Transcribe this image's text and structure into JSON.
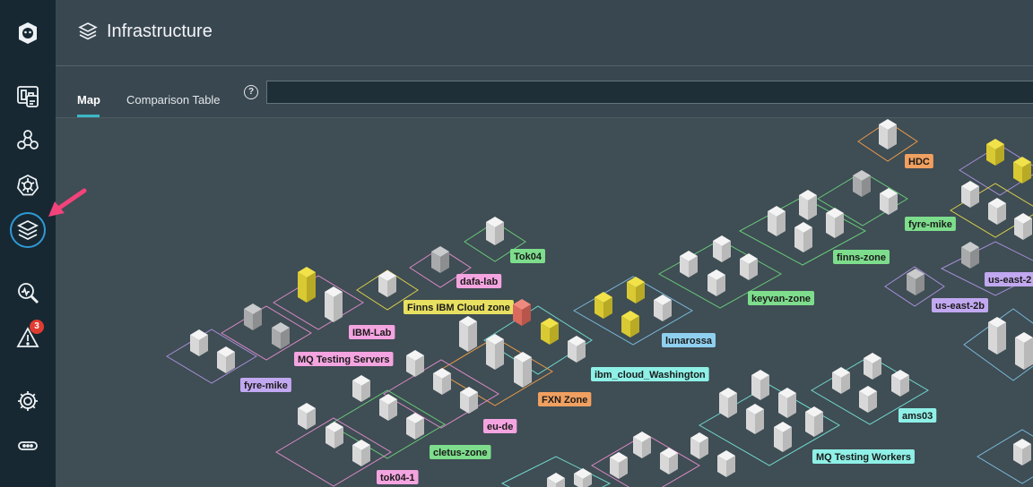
{
  "header": {
    "title": "Infrastructure"
  },
  "tabs": [
    {
      "label": "Map"
    },
    {
      "label": "Comparison Table"
    }
  ],
  "search": {
    "value": "",
    "placeholder": ""
  },
  "sidebar": {
    "items": [
      {
        "icon": "app-logo-icon"
      },
      {
        "icon": "dashboard-icon"
      },
      {
        "icon": "applications-icon"
      },
      {
        "icon": "kubernetes-icon"
      },
      {
        "icon": "infrastructure-stack-icon",
        "active": true
      },
      {
        "icon": "analyze-icon"
      },
      {
        "icon": "events-warning-icon",
        "badge": "3"
      },
      {
        "icon": "settings-gear-icon"
      },
      {
        "icon": "more-icon"
      }
    ]
  },
  "colors": {
    "accent": "#3bb8c6",
    "highlight_arrow": "#f2437a",
    "badge": "#e03c31",
    "host_default": "#f0f0f0",
    "host_warning": "#e6d63a",
    "host_critical": "#e57366"
  },
  "zones": [
    {
      "name": "HDC",
      "tag_color": "#f0a060",
      "border": "#e89a4a",
      "hosts": [
        "default"
      ]
    },
    {
      "name": "fyre-mike",
      "tag_color": "#7ddd8c",
      "border": "#68c97a",
      "hosts": [
        "dim",
        "default"
      ]
    },
    {
      "name": "Tok04",
      "tag_color": "#7ddd8c",
      "border": "#68c97a",
      "hosts": [
        "default"
      ]
    },
    {
      "name": "dafa-lab",
      "tag_color": "#f4a4e0",
      "border": "#d98ac6",
      "hosts": [
        "dim"
      ]
    },
    {
      "name": "finns-zone",
      "tag_color": "#7ddd8c",
      "border": "#68c97a",
      "hosts": [
        "default",
        "default",
        "default",
        "default",
        "default"
      ]
    },
    {
      "name": "keyvan-zone",
      "tag_color": "#7ddd8c",
      "border": "#68c97a",
      "hosts": [
        "default",
        "default",
        "default",
        "default"
      ]
    },
    {
      "name": "us-east-2",
      "tag_color": "#c1a8f0",
      "border": "#a68fd9",
      "hosts": [
        "dim"
      ]
    },
    {
      "name": "us-east-2b",
      "tag_color": "#c1a8f0",
      "border": "#a68fd9",
      "hosts": [
        "dim"
      ]
    },
    {
      "name": "Finns IBM Cloud zone",
      "tag_color": "#e8e060",
      "border": "#d9d04a",
      "hosts": [
        "default"
      ]
    },
    {
      "name": "IBM-Lab",
      "tag_color": "#f4a4e0",
      "border": "#d98ac6",
      "hosts": [
        "warning",
        "default"
      ]
    },
    {
      "name": "MQ Testing Servers",
      "tag_color": "#f4a4e0",
      "border": "#d98ac6",
      "hosts": [
        "dim",
        "dim"
      ]
    },
    {
      "name": "fyre-mike",
      "tag_color": "#c1a8f0",
      "border": "#a68fd9",
      "hosts": [
        "default",
        "default"
      ]
    },
    {
      "name": "lunarossa",
      "tag_color": "#8fd0f0",
      "border": "#7ab8d9",
      "hosts": [
        "warning",
        "warning",
        "warning",
        "default"
      ]
    },
    {
      "name": "ibm_cloud_Washington",
      "tag_color": "#8ef0e6",
      "border": "#70d9cf",
      "hosts": [
        "critical",
        "warning",
        "default"
      ]
    },
    {
      "name": "FXN Zone",
      "tag_color": "#f0a060",
      "border": "#e89a4a",
      "hosts": [
        "default",
        "default",
        "default"
      ]
    },
    {
      "name": "eu-de",
      "tag_color": "#f4a4e0",
      "border": "#d98ac6",
      "hosts": [
        "default",
        "default",
        "default"
      ]
    },
    {
      "name": "cletus-zone",
      "tag_color": "#7ddd8c",
      "border": "#68c97a",
      "hosts": [
        "default",
        "default",
        "default"
      ]
    },
    {
      "name": "tok04-1",
      "tag_color": "#f4a4e0",
      "border": "#d98ac6",
      "hosts": [
        "default",
        "default",
        "default"
      ]
    },
    {
      "name": "ams03",
      "tag_color": "#8ef0e6",
      "border": "#70d9cf",
      "hosts": [
        "default",
        "default",
        "default",
        "default"
      ]
    },
    {
      "name": "MQ Testing Workers",
      "tag_color": "#8ef0e6",
      "border": "#70d9cf",
      "hosts": [
        "default",
        "default",
        "default",
        "default",
        "default",
        "default"
      ]
    }
  ]
}
